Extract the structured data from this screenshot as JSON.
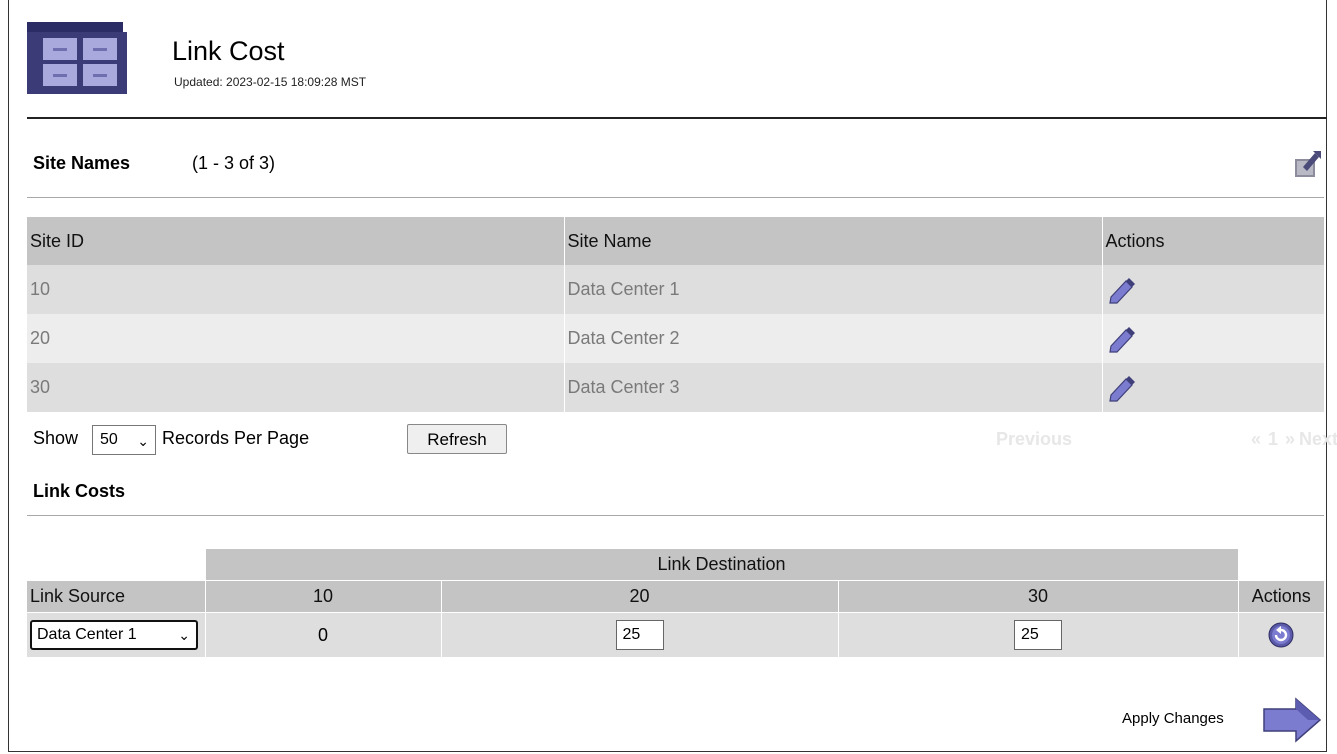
{
  "header": {
    "title": "Link Cost",
    "updated": "Updated: 2023-02-15 18:09:28 MST"
  },
  "site_names": {
    "title": "Site Names",
    "count": "(1 - 3 of 3)",
    "columns": [
      "Site ID",
      "Site Name",
      "Actions"
    ],
    "rows": [
      {
        "id": "10",
        "name": "Data Center 1"
      },
      {
        "id": "20",
        "name": "Data Center 2"
      },
      {
        "id": "30",
        "name": "Data Center 3"
      }
    ],
    "edit_icon": "pencil-icon",
    "export_icon": "export-icon"
  },
  "paging": {
    "show_label": "Show",
    "per_page_value": "50",
    "records_label": "Records Per Page",
    "refresh_label": "Refresh",
    "previous_label": "Previous",
    "first_label": "«",
    "page_label": "1",
    "next_arrow": "»",
    "next_label": "Next"
  },
  "link_costs": {
    "title": "Link Costs",
    "destination_header": "Link Destination",
    "source_header": "Link Source",
    "actions_header": "Actions",
    "destinations": [
      "10",
      "20",
      "30"
    ],
    "source_value": "Data Center 1",
    "cost_10": "0",
    "cost_20": "25",
    "cost_30": "25",
    "revert_icon": "revert-icon"
  },
  "footer": {
    "apply_label": "Apply Changes",
    "apply_icon": "arrow-right-icon"
  },
  "colors": {
    "accent": "#7b7bd0",
    "icon_dark": "#3f3f7a",
    "header_bg": "#c4c4c4",
    "row_odd": "#dedede",
    "row_even": "#ededed"
  }
}
